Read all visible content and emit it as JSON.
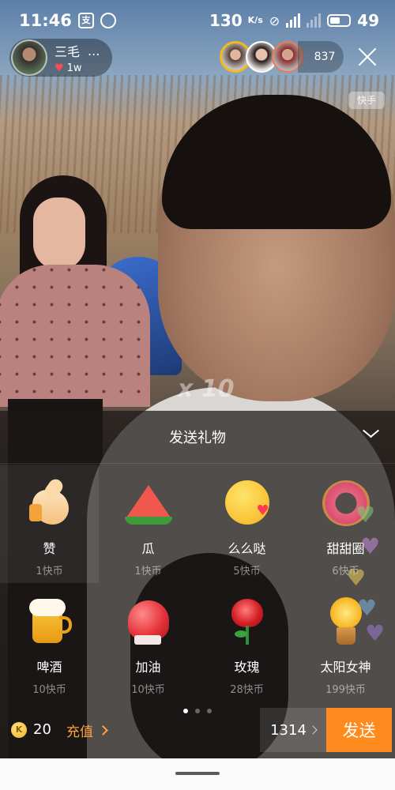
{
  "status_bar": {
    "time": "11:46",
    "left_icons": [
      "alipay-icon",
      "circle-app-icon"
    ],
    "net_speed": "130",
    "net_unit": "K/s",
    "battery": "49"
  },
  "anchor": {
    "name": "三毛",
    "more": "...",
    "likes": "1w"
  },
  "audience": {
    "count": "837"
  },
  "app_watermark": "快手",
  "combo_watermark": "x 10",
  "gift_panel": {
    "title": "发送礼物",
    "gifts": [
      {
        "name": "赞",
        "price": "1快币",
        "icon": "thumbs-up-icon"
      },
      {
        "name": "瓜",
        "price": "1快币",
        "icon": "watermelon-icon"
      },
      {
        "name": "么么哒",
        "price": "5快币",
        "icon": "kiss-face-icon"
      },
      {
        "name": "甜甜圈",
        "price": "6快币",
        "icon": "donut-icon"
      },
      {
        "name": "啤酒",
        "price": "10快币",
        "icon": "beer-icon"
      },
      {
        "name": "加油",
        "price": "10快币",
        "icon": "boxing-glove-icon"
      },
      {
        "name": "玫瑰",
        "price": "28快币",
        "icon": "rose-icon"
      },
      {
        "name": "太阳女神",
        "price": "199快币",
        "icon": "sun-goddess-icon"
      }
    ],
    "selected_index": 0,
    "page_count": 3,
    "current_page": 1
  },
  "footer": {
    "coin_symbol": "K",
    "coin_balance": "20",
    "recharge_label": "充值",
    "quantity": "1314",
    "send_label": "发送"
  },
  "colors": {
    "accent_orange": "#ff8a1e",
    "recharge_orange": "#ffa23b",
    "heart_red": "#ff4b55"
  }
}
